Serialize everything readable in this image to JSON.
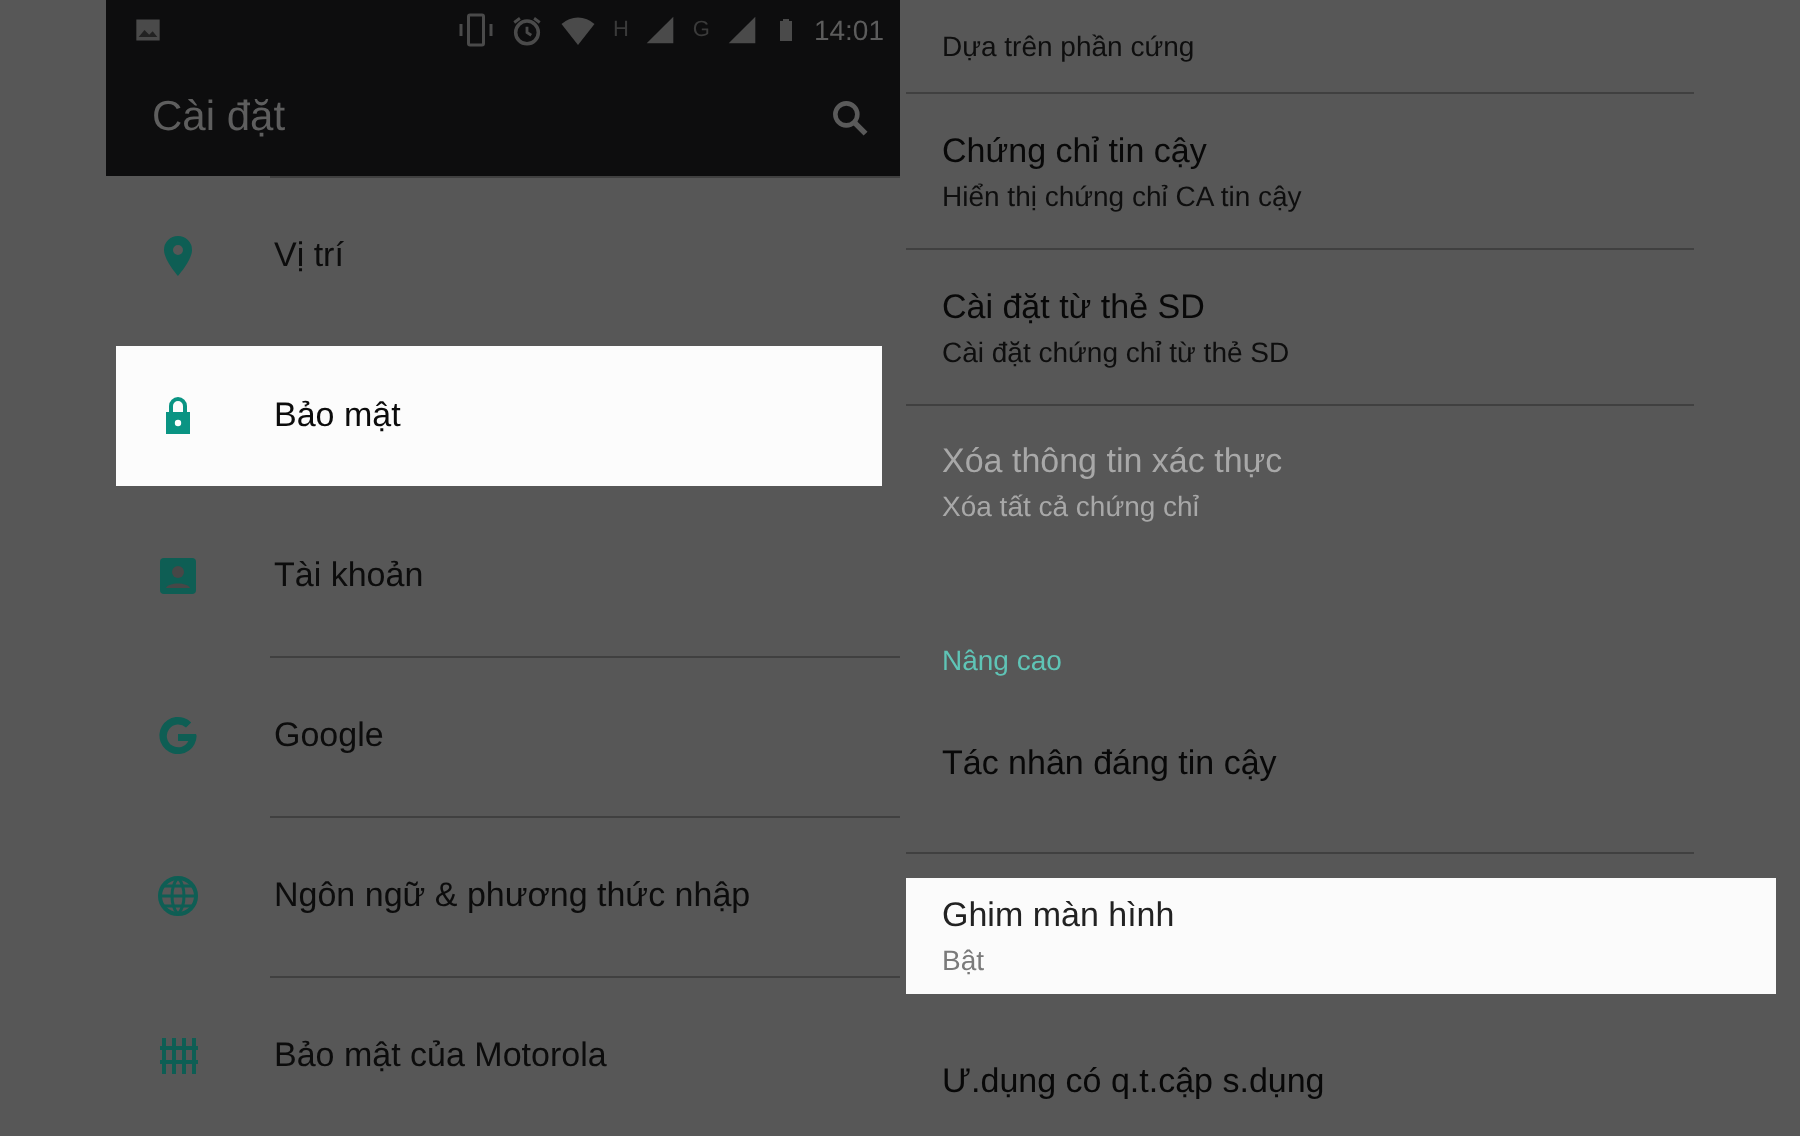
{
  "status_bar": {
    "network_labels": [
      "H",
      "G"
    ],
    "time": "14:01"
  },
  "app_bar": {
    "title": "Cài đặt"
  },
  "settings_list": [
    {
      "label": "Vị trí",
      "selected": false
    },
    {
      "label": "Bảo mật",
      "selected": true
    },
    {
      "label": "Tài khoản",
      "selected": false
    },
    {
      "label": "Google",
      "selected": false
    },
    {
      "label": "Ngôn ngữ & phương thức nhập",
      "selected": false
    },
    {
      "label": "Bảo mật của Motorola",
      "selected": false
    }
  ],
  "security_list": [
    {
      "kind": "partial",
      "subtitle": "Dựa trên phần cứng",
      "disabled": false,
      "selected": false
    },
    {
      "kind": "item",
      "title": "Chứng chỉ tin cậy",
      "subtitle": "Hiển thị chứng chỉ CA tin cậy",
      "disabled": false,
      "selected": false
    },
    {
      "kind": "item",
      "title": "Cài đặt từ thẻ SD",
      "subtitle": "Cài đặt chứng chỉ từ thẻ SD",
      "disabled": false,
      "selected": false
    },
    {
      "kind": "item",
      "title": "Xóa thông tin xác thực",
      "subtitle": "Xóa tất cả chứng chỉ",
      "disabled": true,
      "selected": false
    },
    {
      "kind": "header",
      "title": "Nâng cao"
    },
    {
      "kind": "item",
      "title": "Tác nhân đáng tin cậy",
      "disabled": false,
      "selected": false
    },
    {
      "kind": "item",
      "title": "Ghim màn hình",
      "subtitle": "Bật",
      "disabled": false,
      "selected": true
    },
    {
      "kind": "item",
      "title": "Ư.dụng có q.t.cập s.dụng",
      "disabled": false,
      "selected": false
    }
  ]
}
